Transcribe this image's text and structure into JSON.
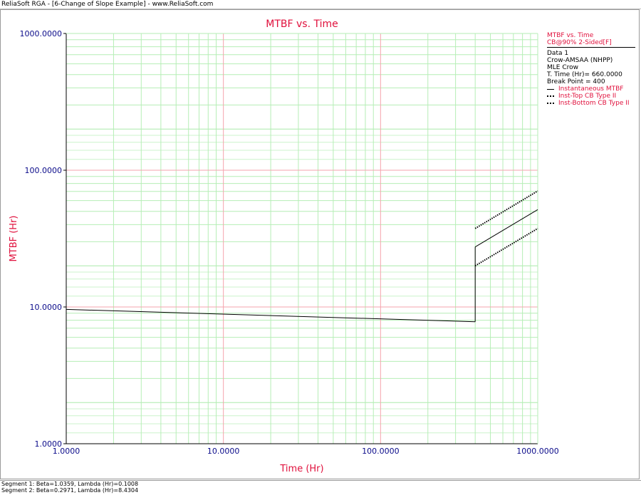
{
  "window": {
    "title": "ReliaSoft RGA - [6-Change of Slope Example] - www.ReliaSoft.com"
  },
  "legend": {
    "header": "MTBF vs. Time",
    "confidence": "CB@90% 2-Sided[F]",
    "data_name": "Data 1",
    "model": "Crow-AMSAA (NHPP)",
    "method": "MLE Crow",
    "total_time": "T. Time (Hr)= 660.0000",
    "break_point": "Break Point = 400",
    "items": [
      {
        "label": "Instantaneous MTBF",
        "style": "solid"
      },
      {
        "label": "Inst-Top CB Type II",
        "style": "dotted"
      },
      {
        "label": "Inst-Bottom CB Type II",
        "style": "dotted"
      }
    ]
  },
  "status": {
    "segment1": "Segment 1: Beta=1.0359, Lambda (Hr)=0.1008",
    "segment2": "Segment 2: Beta=0.2971, Lambda (Hr)=8.4304"
  },
  "chart_data": {
    "type": "line",
    "title": "MTBF vs. Time",
    "xlabel": "Time (Hr)",
    "ylabel": "MTBF (Hr)",
    "x_scale": "log",
    "y_scale": "log",
    "xlim": [
      1,
      1000
    ],
    "ylim": [
      1,
      1000
    ],
    "x_ticks": [
      "1.0000",
      "10.0000",
      "100.0000",
      "1000.0000"
    ],
    "y_ticks": [
      "1.0000",
      "10.0000",
      "100.0000",
      "1000.0000"
    ],
    "grid": true,
    "legend_position": "right",
    "colors": {
      "title": "#e0103c",
      "axis_label": "#e0103c",
      "tick_label": "#0b0b8a",
      "major_grid": "#f5a3ad",
      "minor_grid": "#b6eeb6",
      "line": "#000000"
    },
    "series": [
      {
        "name": "Instantaneous MTBF",
        "style": "solid",
        "segments": [
          {
            "x": [
              1,
              400
            ],
            "y": [
              9.6,
              7.8
            ]
          },
          {
            "x": [
              400,
              1000
            ],
            "y": [
              27.5,
              51.5
            ]
          }
        ]
      },
      {
        "name": "Inst-Top CB Type II",
        "style": "dotted",
        "segments": [
          {
            "x": [
              400,
              1000
            ],
            "y": [
              37.5,
              70.5
            ]
          }
        ]
      },
      {
        "name": "Inst-Bottom CB Type II",
        "style": "dotted",
        "segments": [
          {
            "x": [
              400,
              1000
            ],
            "y": [
              20,
              37.5
            ]
          }
        ]
      }
    ]
  }
}
